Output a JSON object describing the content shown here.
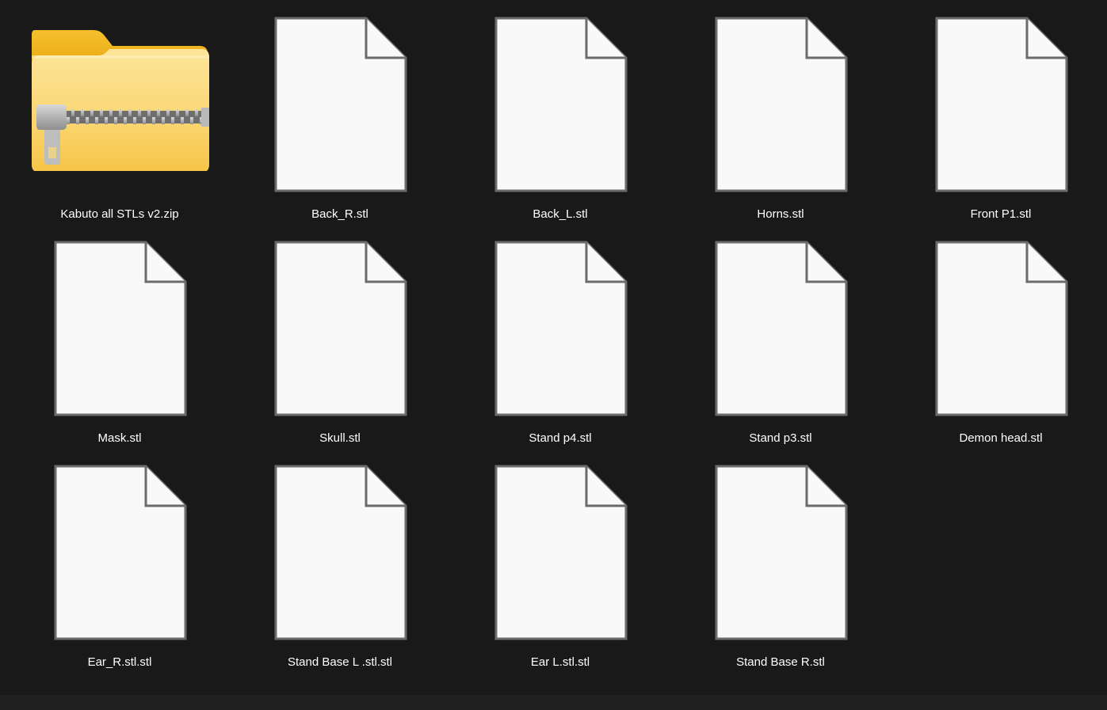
{
  "colors": {
    "background": "#191919",
    "label_text": "#ffffff",
    "file_page": "#f9f9f9",
    "file_border": "#6b6b6b",
    "folder_yellow": "#f8d469",
    "zipper": "#9b9b9b"
  },
  "files": [
    {
      "name": "Kabuto all STLs v2.zip",
      "icon": "zip-folder-icon"
    },
    {
      "name": "Back_R.stl",
      "icon": "file-icon"
    },
    {
      "name": "Back_L.stl",
      "icon": "file-icon"
    },
    {
      "name": "Horns.stl",
      "icon": "file-icon"
    },
    {
      "name": "Front P1.stl",
      "icon": "file-icon"
    },
    {
      "name": "Mask.stl",
      "icon": "file-icon"
    },
    {
      "name": "Skull.stl",
      "icon": "file-icon"
    },
    {
      "name": "Stand p4.stl",
      "icon": "file-icon"
    },
    {
      "name": "Stand p3.stl",
      "icon": "file-icon"
    },
    {
      "name": "Demon head.stl",
      "icon": "file-icon"
    },
    {
      "name": "Ear_R.stl.stl",
      "icon": "file-icon"
    },
    {
      "name": "Stand Base L .stl.stl",
      "icon": "file-icon"
    },
    {
      "name": "Ear L.stl.stl",
      "icon": "file-icon"
    },
    {
      "name": "Stand Base R.stl",
      "icon": "file-icon"
    }
  ]
}
